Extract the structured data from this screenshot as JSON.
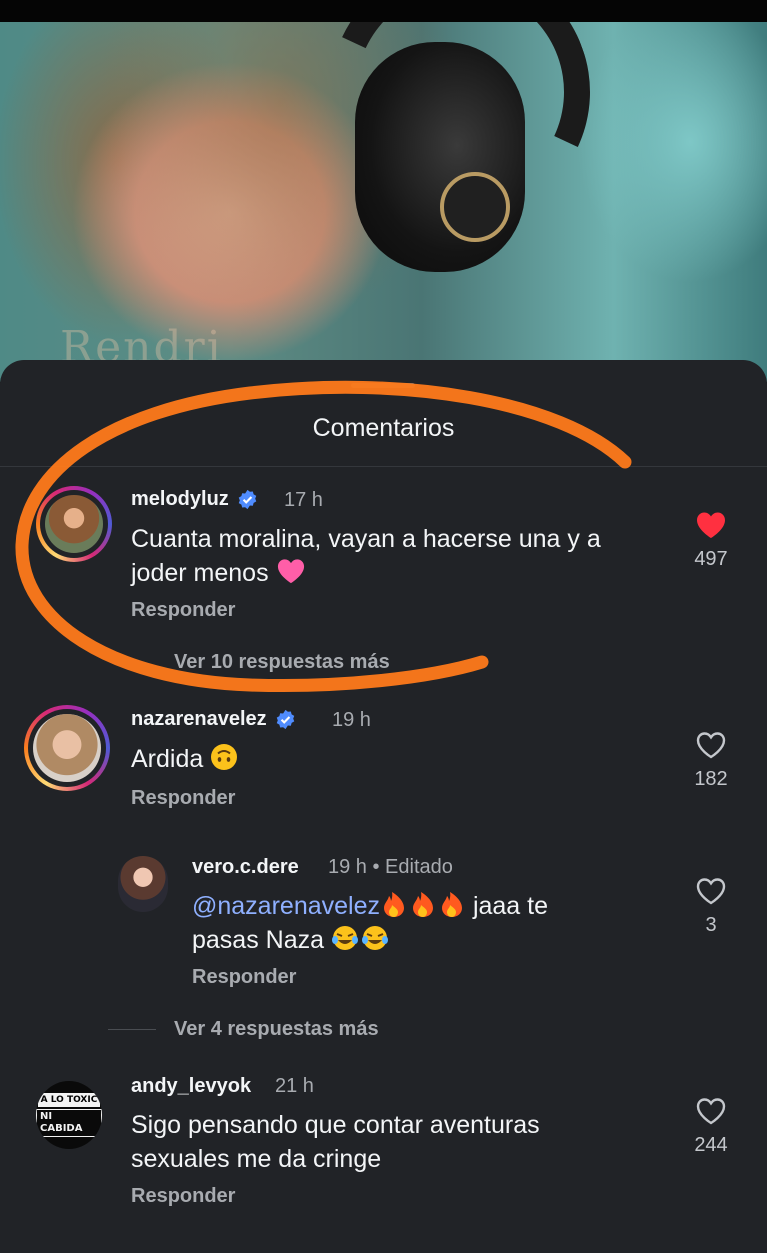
{
  "colors": {
    "sheet_bg": "#212327",
    "verified": "#4f8cff",
    "heart_liked": "#ff3040",
    "mention": "#8fb0ff",
    "annotation": "#ff7a1a"
  },
  "video": {
    "watermark": "Rendri"
  },
  "sheet": {
    "title": "Comentarios"
  },
  "comments": [
    {
      "username": "melodyluz",
      "verified": true,
      "time": "17 h",
      "text_parts": [
        "Cuanta moralina, vayan a hacerse una y a",
        "joder menos"
      ],
      "emoji": "heart",
      "reply_label": "Responder",
      "likes": "497",
      "liked": true,
      "more_replies": "Ver 10 respuestas más"
    },
    {
      "username": "nazarenavelez",
      "verified": true,
      "time": "19 h",
      "text": "Ardida",
      "emoji": "upside-down-face",
      "reply_label": "Responder",
      "likes": "182",
      "liked": false,
      "replies": [
        {
          "username": "vero.c.dere",
          "time": "19 h • Editado",
          "mention": "@nazarenavelez",
          "emoji_after_mention": "fire x3",
          "text_after": " jaaa te",
          "text_line2": "pasas Naza",
          "emoji_end": "joy x2",
          "reply_label": "Responder",
          "likes": "3",
          "liked": false
        }
      ],
      "more_replies": "Ver 4 respuestas más"
    },
    {
      "username": "andy_levyok",
      "verified": false,
      "time": "21 h",
      "avatar_text": [
        "A LO TOXIC",
        "NI CABIDA"
      ],
      "text_parts": [
        "Sigo pensando que contar aventuras",
        "sexuales me da cringe"
      ],
      "reply_label": "Responder",
      "likes": "244",
      "liked": false
    }
  ]
}
